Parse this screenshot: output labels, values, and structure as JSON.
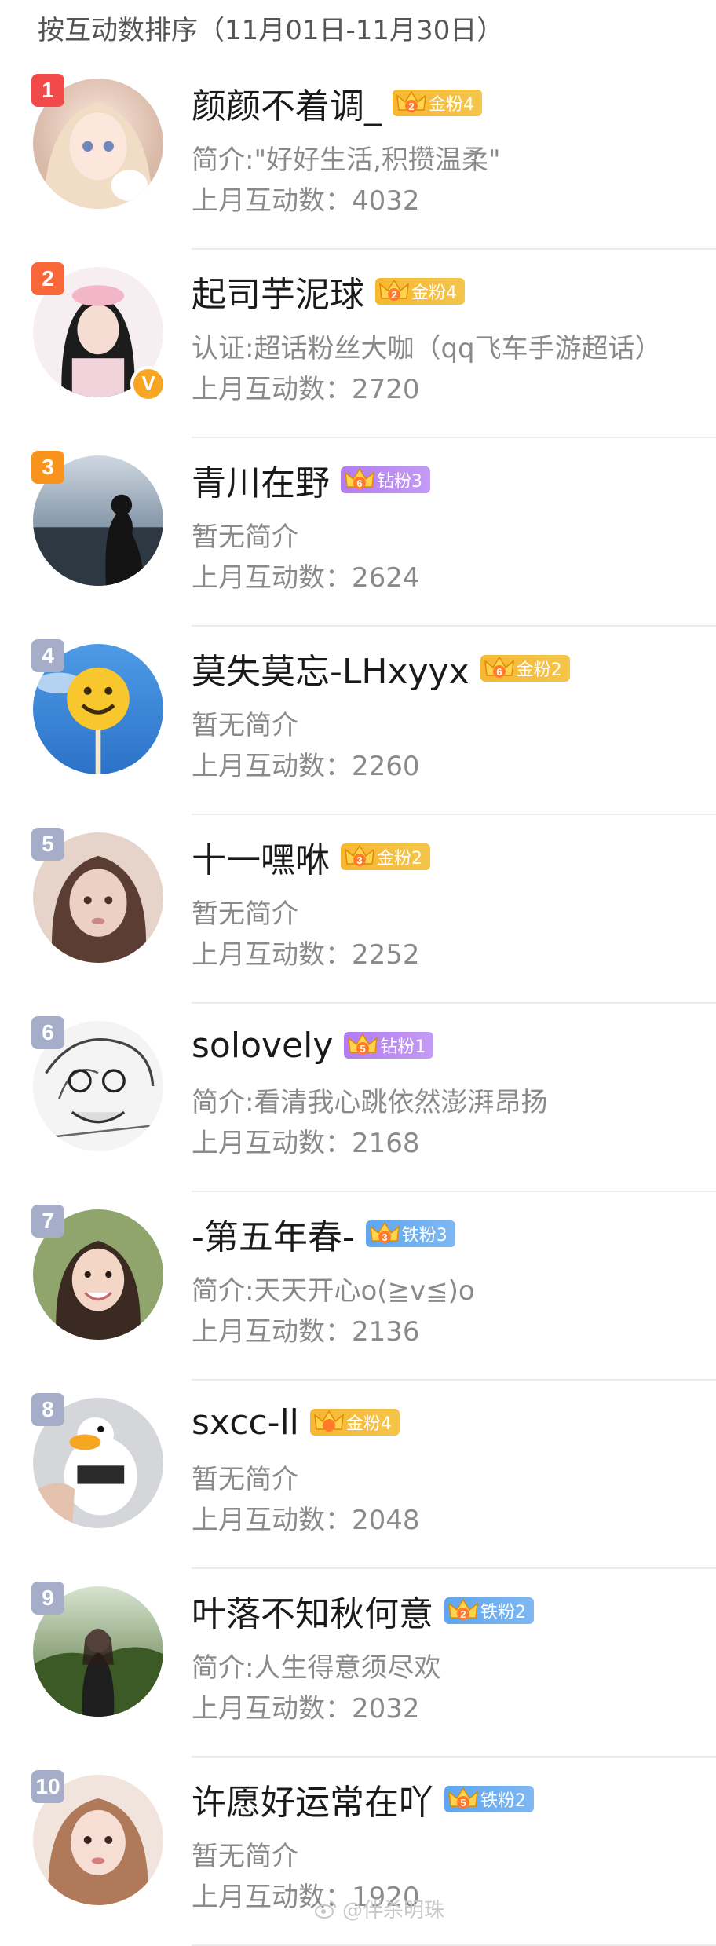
{
  "header": {
    "title": "按互动数排序（11月01日-11月30日）"
  },
  "count_prefix": "上月互动数：",
  "users": [
    {
      "rank": "1",
      "name": "颜颜不着调_",
      "badge": {
        "level": "2",
        "label": "金粉4",
        "type": "gold",
        "color": "#f7b733"
      },
      "bio": "简介:\"好好生活,积攒温柔\"",
      "count": "4032",
      "rank_color": "#f24a4a",
      "verified": false
    },
    {
      "rank": "2",
      "name": "起司芋泥球",
      "badge": {
        "level": "2",
        "label": "金粉4",
        "type": "gold",
        "color": "#f7b733"
      },
      "bio": "认证:超话粉丝大咖（qq飞车手游超话）",
      "count": "2720",
      "rank_color": "#f7673a",
      "verified": true
    },
    {
      "rank": "3",
      "name": "青川在野",
      "badge": {
        "level": "6",
        "label": "钻粉3",
        "type": "diamond",
        "color": "#b27cf0"
      },
      "bio": "暂无简介",
      "count": "2624",
      "rank_color": "#f8941d",
      "verified": false
    },
    {
      "rank": "4",
      "name": "莫失莫忘-LHxyyx",
      "badge": {
        "level": "6",
        "label": "金粉2",
        "type": "gold",
        "color": "#f7b733"
      },
      "bio": "暂无简介",
      "count": "2260",
      "rank_color": "#a6adc8",
      "verified": false
    },
    {
      "rank": "5",
      "name": "十一嘿咻",
      "badge": {
        "level": "3",
        "label": "金粉2",
        "type": "gold",
        "color": "#f7b733"
      },
      "bio": "暂无简介",
      "count": "2252",
      "rank_color": "#a6adc8",
      "verified": false
    },
    {
      "rank": "6",
      "name": "solovely",
      "badge": {
        "level": "5",
        "label": "钻粉1",
        "type": "diamond",
        "color": "#b27cf0"
      },
      "bio": "简介:看清我心跳依然澎湃昂扬",
      "count": "2168",
      "rank_color": "#a6adc8",
      "verified": false
    },
    {
      "rank": "7",
      "name": "-第五年春-",
      "badge": {
        "level": "3",
        "label": "铁粉3",
        "type": "iron",
        "color": "#5fa6ef"
      },
      "bio": "简介:天天开心o(≧v≦)o",
      "count": "2136",
      "rank_color": "#a6adc8",
      "verified": false
    },
    {
      "rank": "8",
      "name": "sxcc-ll",
      "badge": {
        "level": "",
        "label": "金粉4",
        "type": "gold",
        "color": "#f7b733"
      },
      "bio": "暂无简介",
      "count": "2048",
      "rank_color": "#a6adc8",
      "verified": false
    },
    {
      "rank": "9",
      "name": "叶落不知秋何意",
      "badge": {
        "level": "2",
        "label": "铁粉2",
        "type": "iron",
        "color": "#5fa6ef"
      },
      "bio": "简介:人生得意须尽欢",
      "count": "2032",
      "rank_color": "#a6adc8",
      "verified": false
    },
    {
      "rank": "10",
      "name": "许愿好运常在吖",
      "badge": {
        "level": "5",
        "label": "铁粉2",
        "type": "iron",
        "color": "#5fa6ef"
      },
      "bio": "暂无简介",
      "count": "1920",
      "rank_color": "#a6adc8",
      "verified": false
    }
  ],
  "verified_mark": "V",
  "watermark": "@伴杀明珠"
}
